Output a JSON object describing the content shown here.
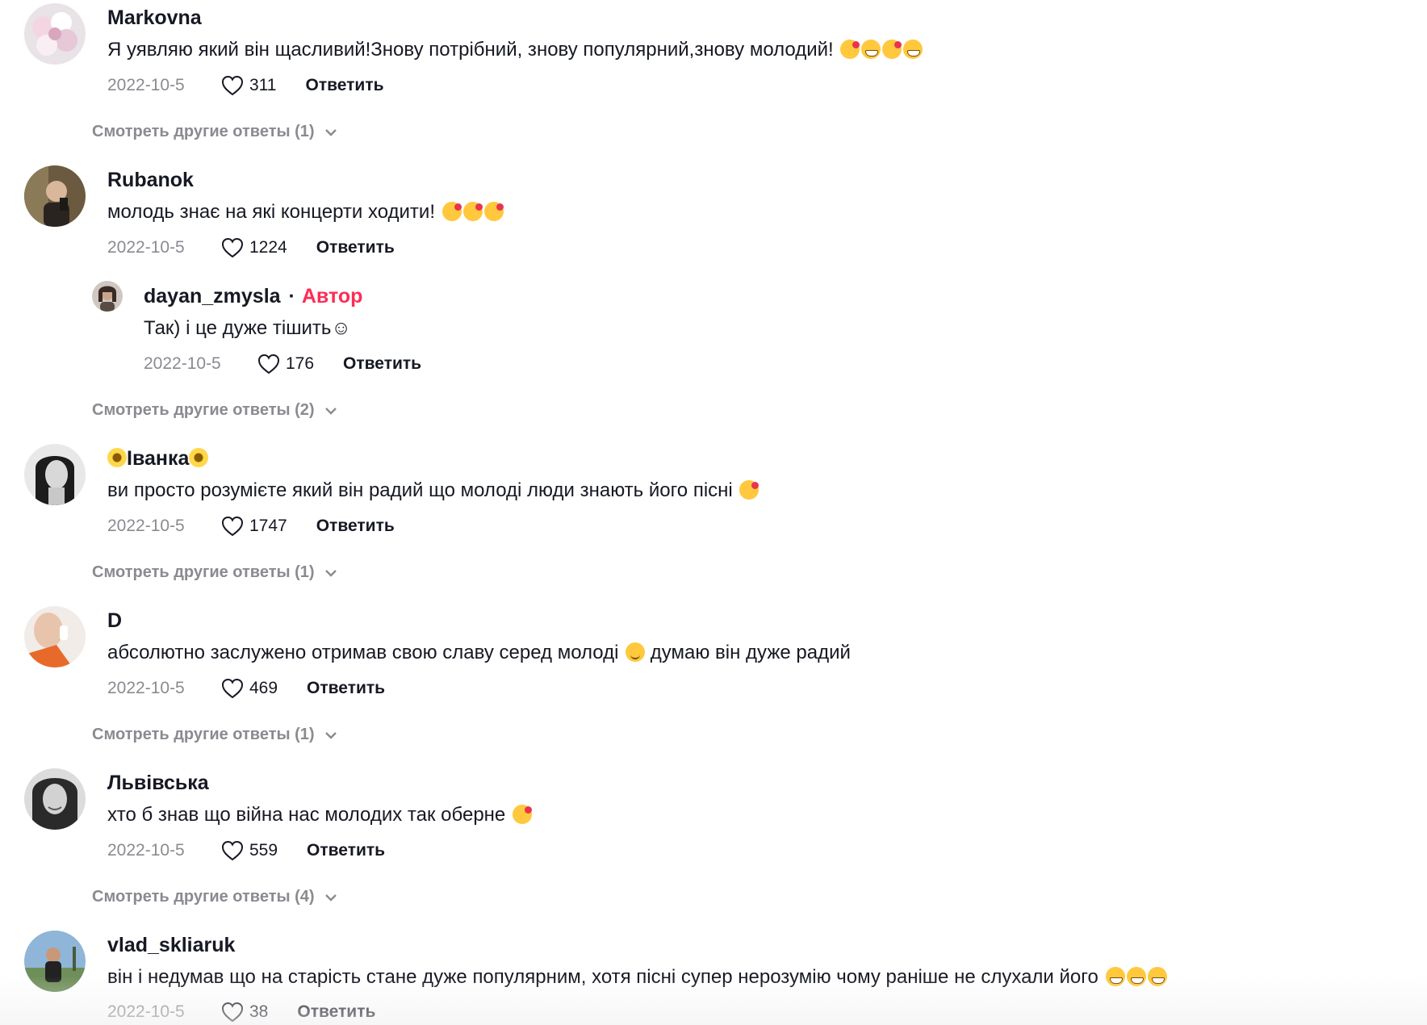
{
  "ui": {
    "reply_label": "Ответить",
    "author_label": "Автор"
  },
  "comments": [
    {
      "username": "Markovna",
      "text": "Я уявляю який він щасливий!Знову потрібний, знову популярний,знову молодий! ",
      "emojis": [
        "smiling-face-with-hearts",
        "grinning-face",
        "smiling-face-with-hearts",
        "grinning-face"
      ],
      "date": "2022-10-5",
      "likes": "311",
      "more_replies": "Смотреть другие ответы (1)"
    },
    {
      "username": "Rubanok",
      "text": "молодь знає на які концерти ходити! ",
      "emojis": [
        "smiling-face-with-hearts",
        "smiling-face-with-hearts",
        "smiling-face-with-hearts"
      ],
      "date": "2022-10-5",
      "likes": "1224",
      "reply": {
        "username": "dayan_zmysla",
        "separator": "·",
        "text": "Так) і це дуже тішить☺",
        "date": "2022-10-5",
        "likes": "176"
      },
      "more_replies": "Смотреть другие ответы (2)"
    },
    {
      "username": "Іванка",
      "text": "ви просто розумієте який він радий що молоді люди знають його пісні ",
      "emojis": [
        "smiling-face-with-hearts"
      ],
      "date": "2022-10-5",
      "likes": "1747",
      "more_replies": "Смотреть другие ответы (1)"
    },
    {
      "username": "D",
      "text": "абсолютно заслужено отримав свою славу серед молоді ",
      "emojis": [
        "relieved-face"
      ],
      "text_after": " думаю він дуже радий",
      "date": "2022-10-5",
      "likes": "469",
      "more_replies": "Смотреть другие ответы (1)"
    },
    {
      "username": "Львівська",
      "text": "хто б знав що війна нас молодих так оберне ",
      "emojis": [
        "smiling-face-with-hearts"
      ],
      "date": "2022-10-5",
      "likes": "559",
      "more_replies": "Смотреть другие ответы (4)"
    },
    {
      "username": "vlad_skliaruk",
      "text": "він і недумав що на старість стане дуже популярним, хотя пісні супер нерозумію чому раніше не слухали його ",
      "emojis": [
        "grinning-face",
        "grinning-face",
        "grinning-face"
      ],
      "date": "2022-10-5",
      "likes": "38"
    }
  ],
  "colors": {
    "text": "#161823",
    "secondary": "#8a8b91",
    "author_badge": "#fe2c55"
  },
  "icons": {
    "like": "heart-outline-icon",
    "expand": "chevron-down-icon"
  }
}
